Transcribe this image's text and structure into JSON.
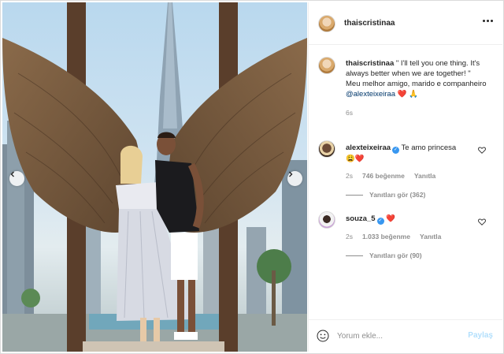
{
  "post": {
    "author": {
      "username": "thaiscristinaa"
    },
    "caption": {
      "username": "thaiscristinaa",
      "quote": "\" I'll tell you one thing. It's always better when we are together! \"",
      "body": "Meu melhor amigo, marido e companheiro",
      "mention": "@alexteixeiraa",
      "emoji": "❤️ 🙏",
      "time": "6s"
    },
    "comments": [
      {
        "username": "alexteixeiraa",
        "verified": true,
        "text": "Te amo princesa",
        "emoji": "😩❤️",
        "time": "2s",
        "likes": "746 beğenme",
        "reply_label": "Yanıtla",
        "view_replies": "Yanıtları gör (362)"
      },
      {
        "username": "souza_5",
        "verified": true,
        "text": "",
        "emoji": "❤️",
        "time": "2s",
        "likes": "1.033 beğenme",
        "reply_label": "Yanıtla",
        "view_replies": "Yanıtları gör (90)"
      }
    ]
  },
  "composer": {
    "placeholder": "Yorum ekle...",
    "post_label": "Paylaş"
  },
  "icons": {
    "more": "more-options-icon",
    "like": "heart-outline-icon",
    "emoji": "emoji-smiley-icon",
    "prev": "chevron-left-icon",
    "next": "chevron-right-icon",
    "verified": "verified-badge-icon"
  },
  "colors": {
    "link": "#00376b",
    "verified": "#3897f0",
    "heart": "#ed4956",
    "muted": "#8e8e8e",
    "post_button_disabled": "#b2dffc"
  }
}
